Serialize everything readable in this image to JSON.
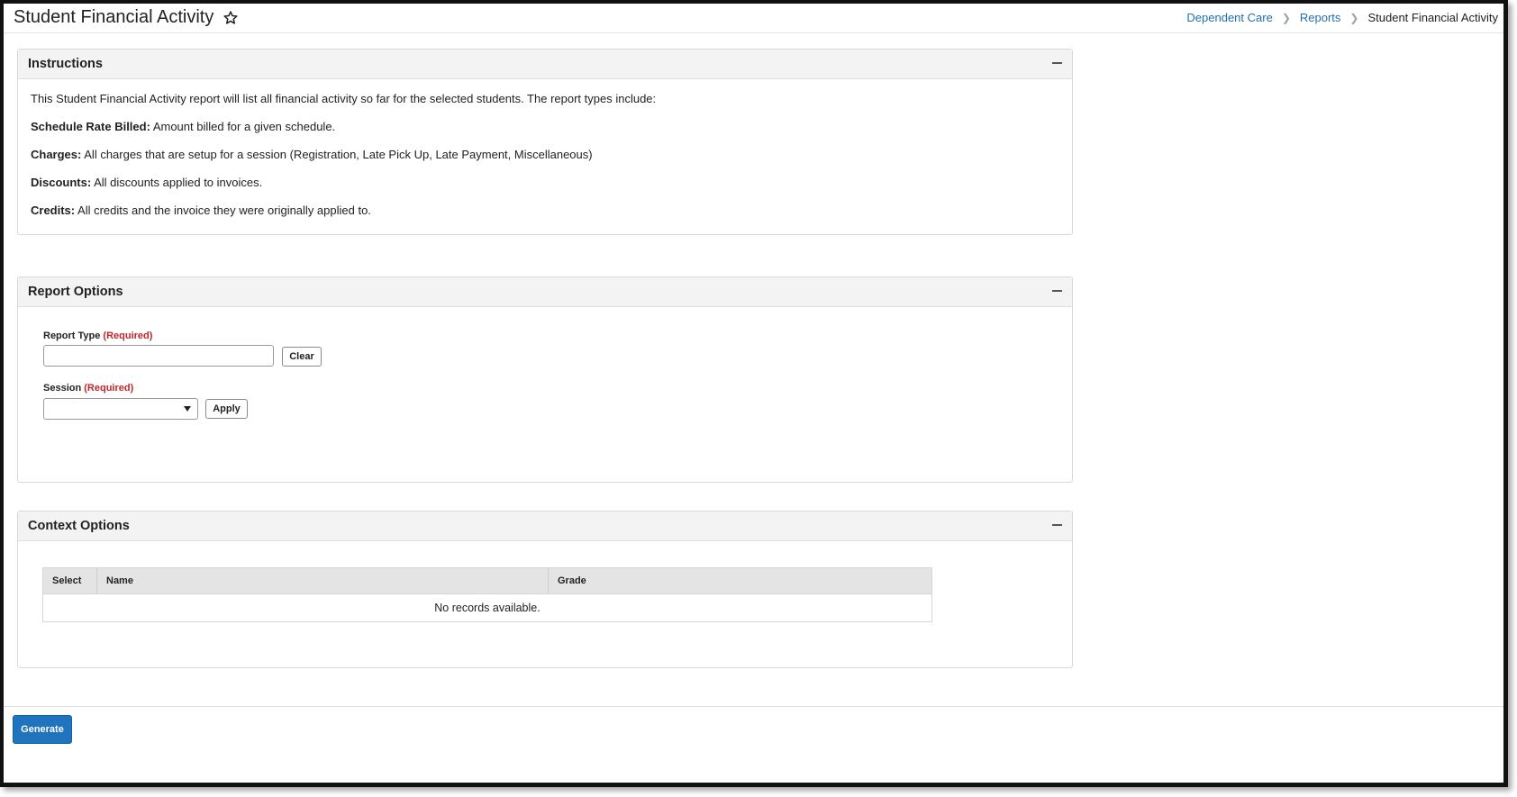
{
  "header": {
    "title": "Student Financial Activity",
    "breadcrumb": [
      {
        "label": "Dependent Care"
      },
      {
        "label": "Reports"
      },
      {
        "label": "Student Financial Activity"
      }
    ]
  },
  "instructions": {
    "title": "Instructions",
    "intro": "This Student Financial Activity report will list all financial activity so far for the selected students. The report types include:",
    "items": [
      {
        "term": "Schedule Rate Billed:",
        "text": " Amount billed for a given schedule."
      },
      {
        "term": "Charges:",
        "text": " All charges that are setup for a session (Registration, Late Pick Up, Late Payment, Miscellaneous)"
      },
      {
        "term": "Discounts:",
        "text": " All discounts applied to invoices."
      },
      {
        "term": "Credits:",
        "text": " All credits and the invoice they were originally applied to."
      }
    ]
  },
  "report_options": {
    "title": "Report Options",
    "report_type_label": "Report Type",
    "report_type_value": "",
    "required_text": "(Required)",
    "clear_label": "Clear",
    "session_label": "Session",
    "session_value": "",
    "apply_label": "Apply"
  },
  "context_options": {
    "title": "Context Options",
    "columns": [
      "Select",
      "Name",
      "Grade"
    ],
    "empty_text": "No records available."
  },
  "footer": {
    "generate_label": "Generate"
  },
  "colors": {
    "link": "#1f6fb3",
    "required": "#c0262d",
    "primary_button": "#1f74bd"
  }
}
